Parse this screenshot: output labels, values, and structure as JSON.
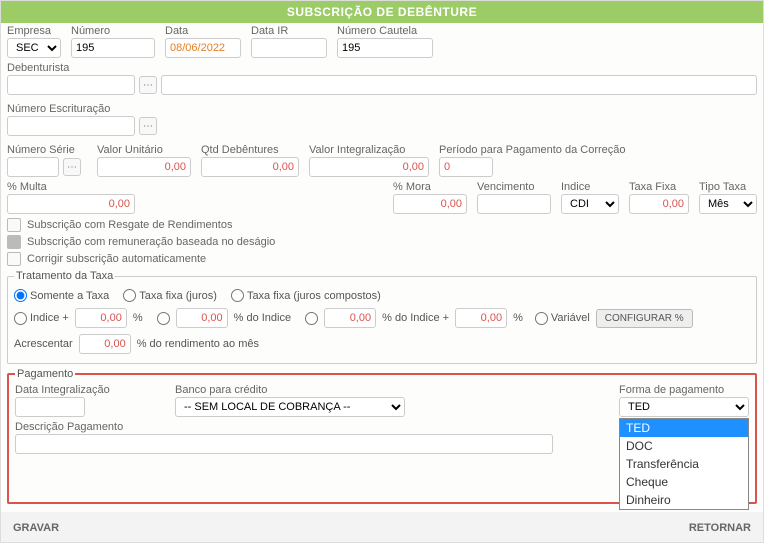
{
  "header": {
    "title": "SUBSCRIÇÃO DE DEBÊNTURE"
  },
  "top": {
    "empresa_label": "Empresa",
    "empresa_value": "SEC",
    "numero_label": "Número",
    "numero_value": "195",
    "data_label": "Data",
    "data_value": "08/06/2022",
    "data_ir_label": "Data IR",
    "data_ir_value": "",
    "numero_cautela_label": "Número Cautela",
    "numero_cautela_value": "195"
  },
  "debenturista": {
    "label": "Debenturista",
    "value1": "",
    "value2": ""
  },
  "escrituracao": {
    "label": "Número Escrituração",
    "value": ""
  },
  "valores": {
    "num_serie_label": "Número Série",
    "num_serie_value": "",
    "valor_unitario_label": "Valor Unitário",
    "valor_unitario_value": "0,00",
    "qtd_label": "Qtd Debêntures",
    "qtd_value": "0,00",
    "valor_integ_label": "Valor Integralização",
    "valor_integ_value": "0,00",
    "periodo_label": "Período para Pagamento da Correção",
    "periodo_value": "0"
  },
  "taxas": {
    "multa_label": "% Multa",
    "multa_value": "0,00",
    "mora_label": "% Mora",
    "mora_value": "0,00",
    "vencimento_label": "Vencimento",
    "vencimento_value": "",
    "indice_label": "Indice",
    "indice_value": "CDI",
    "taxa_fixa_label": "Taxa Fixa",
    "taxa_fixa_value": "0,00",
    "tipo_taxa_label": "Tipo Taxa",
    "tipo_taxa_value": "Mês"
  },
  "checks": {
    "c1": "Subscrição com Resgate de Rendimentos",
    "c2": "Subscrição com remuneração baseada no deságio",
    "c3": "Corrigir subscrição automaticamente"
  },
  "tratamento": {
    "legend": "Tratamento da Taxa",
    "r1": "Somente a Taxa",
    "r2": "Taxa fixa (juros)",
    "r3": "Taxa fixa (juros compostos)",
    "indice_mais": "Indice +",
    "v1": "0,00",
    "pct": "%",
    "v2": "0,00",
    "do_indice": "% do Indice",
    "v3": "0,00",
    "do_indice_mais": "% do Indice +",
    "v4": "0,00",
    "variavel": "Variável",
    "config": "CONFIGURAR %",
    "acrescentar": "Acrescentar",
    "v5": "0,00",
    "rendimento": "% do rendimento ao mês"
  },
  "pagamento": {
    "legend": "Pagamento",
    "data_integ_label": "Data Integralização",
    "data_integ_value": "",
    "banco_label": "Banco para crédito",
    "banco_value": "-- SEM LOCAL DE COBRANÇA --",
    "forma_label": "Forma de pagamento",
    "forma_value": "TED",
    "forma_options": [
      "TED",
      "DOC",
      "Transferência",
      "Cheque",
      "Dinheiro"
    ],
    "descricao_label": "Descrição Pagamento",
    "descricao_value": ""
  },
  "footer": {
    "gravar": "GRAVAR",
    "retornar": "RETORNAR"
  }
}
